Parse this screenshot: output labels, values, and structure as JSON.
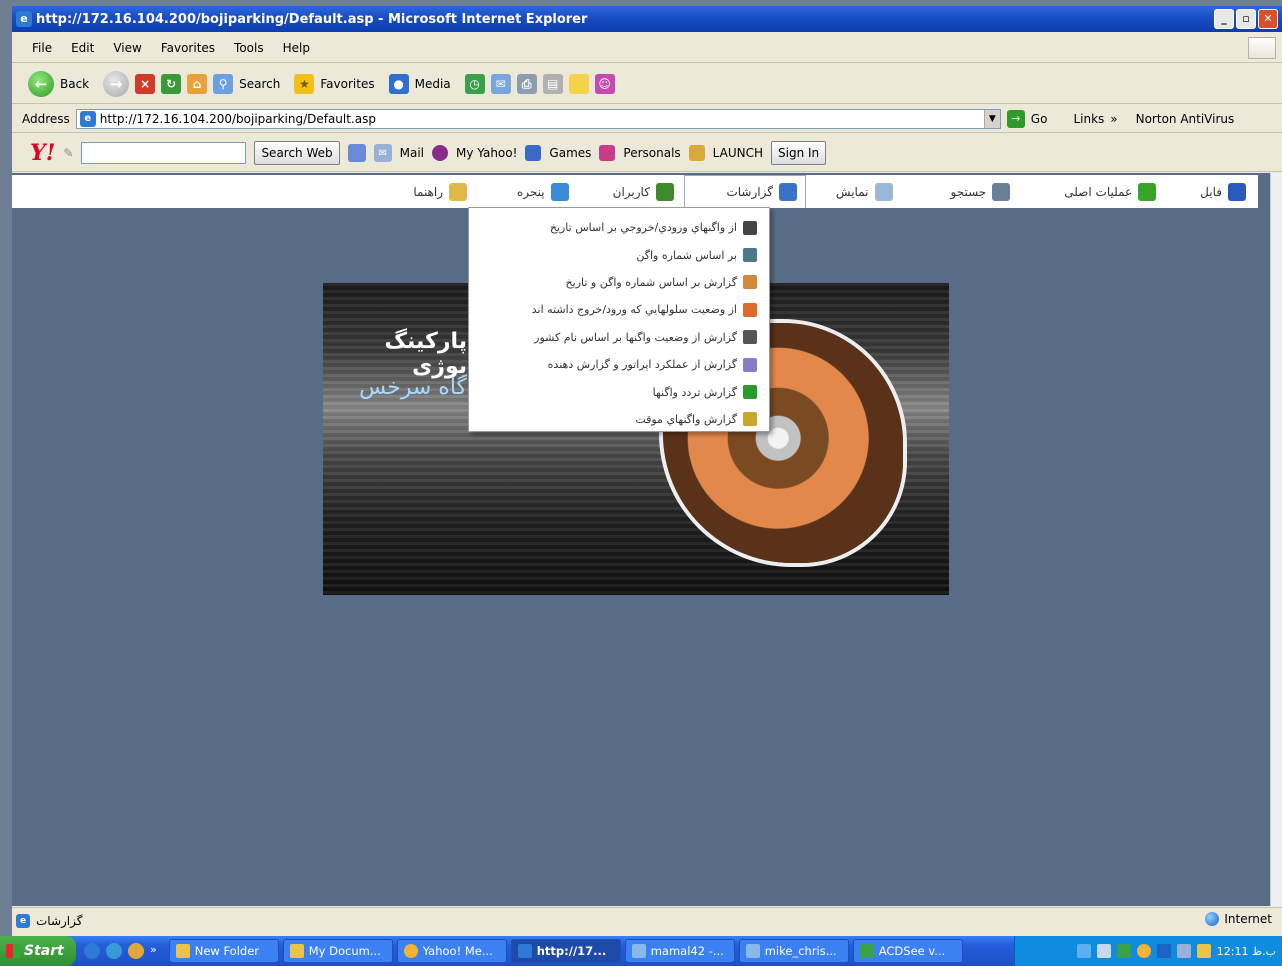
{
  "window": {
    "title": "http://172.16.104.200/bojiparking/Default.asp - Microsoft Internet Explorer"
  },
  "menubar": [
    "File",
    "Edit",
    "View",
    "Favorites",
    "Tools",
    "Help"
  ],
  "toolbar": {
    "back": "Back",
    "search": "Search",
    "favorites": "Favorites",
    "media": "Media"
  },
  "address": {
    "label": "Address",
    "url": "http://172.16.104.200/bojiparking/Default.asp",
    "go": "Go",
    "links": "Links",
    "chevron": "»",
    "norton": "Norton AntiVirus"
  },
  "yahoo": {
    "logo": "Y!",
    "search_web": "Search Web",
    "mail": "Mail",
    "my_yahoo": "My Yahoo!",
    "games": "Games",
    "personals": "Personals",
    "launch": "LAUNCH",
    "sign_in": "Sign In"
  },
  "nav": {
    "items": [
      {
        "label": "فایل",
        "color": "#2a5bb8"
      },
      {
        "label": "عملیات اصلی",
        "color": "#37a52c"
      },
      {
        "label": "جستجو",
        "color": "#6c7f9a"
      },
      {
        "label": "نمایش",
        "color": "#9ab8d8"
      },
      {
        "label": "گزارشات",
        "color": "#3a74c8"
      },
      {
        "label": "کاربران",
        "color": "#3e8a2c"
      },
      {
        "label": "پنجره",
        "color": "#3a8ad8"
      },
      {
        "label": "راهنما",
        "color": "#e0b84a"
      }
    ]
  },
  "dropdown": {
    "items": [
      {
        "label": "از واگنهاي ورودي/خروجي بر اساس تاريخ",
        "color": "#444"
      },
      {
        "label": "بر اساس شماره واگن",
        "color": "#4a7a8a"
      },
      {
        "label": "گزارش بر اساس شماره واگن و تاريخ",
        "color": "#d08a3a"
      },
      {
        "label": "از وضعيت سلولهايي که ورود/خروج داشته اند",
        "color": "#e06a2a"
      },
      {
        "label": "گزارش از وضعيت واگنها بر اساس نام کشور",
        "color": "#555"
      },
      {
        "label": "گزارش از عملکرد اپراتور و گزارش دهنده",
        "color": "#8a7ac8"
      },
      {
        "label": "گزارش تردد واگنها",
        "color": "#2a9a2a"
      },
      {
        "label": "گزارش واگنهاي موقت",
        "color": "#c8a82a"
      }
    ]
  },
  "banner": {
    "line1": "پارکینگ بوژی",
    "line2": "گاه سرخس"
  },
  "statusbar": {
    "text": "گزارشات",
    "zone": "Internet"
  },
  "taskbar": {
    "start": "Start",
    "chevron": "»",
    "tasks": [
      {
        "label": "New Folder",
        "color": "#e8c44a",
        "active": false
      },
      {
        "label": "My Docum...",
        "color": "#e8c44a",
        "active": false
      },
      {
        "label": "Yahoo! Me...",
        "color": "#f2b234",
        "active": false
      },
      {
        "label": "http://17...",
        "color": "#2e7bd6",
        "active": true
      },
      {
        "label": "mamal42 -...",
        "color": "#8ab8e8",
        "active": false
      },
      {
        "label": "mike_chris...",
        "color": "#8ab8e8",
        "active": false
      },
      {
        "label": "ACDSee v...",
        "color": "#3aa04a",
        "active": false
      }
    ],
    "clock": "12:11 ب.ظ"
  }
}
